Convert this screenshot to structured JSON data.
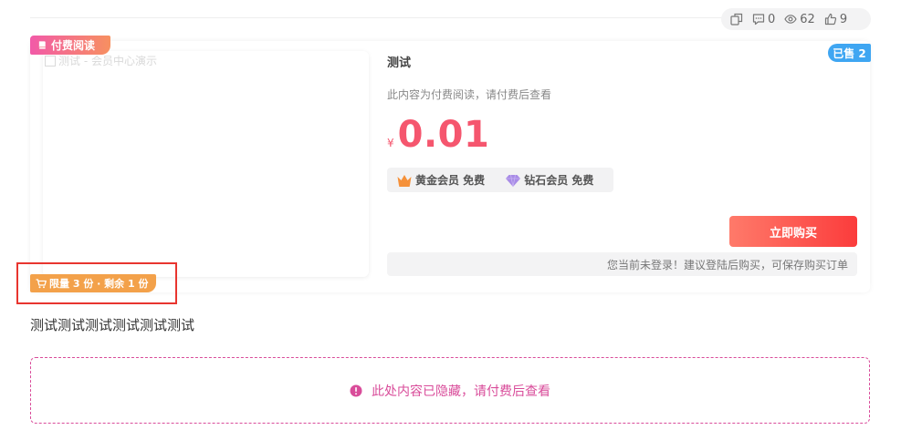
{
  "stats": {
    "comments": "0",
    "views": "62",
    "likes": "9"
  },
  "card": {
    "paid_tag": "付费阅读",
    "sold_badge": "已售 2",
    "cover_alt": "测试 - 会员中心演示",
    "title": "测试",
    "description": "此内容为付费阅读，请付费后查看",
    "price_currency": "¥",
    "price_value": "0.01",
    "members": [
      {
        "label": "黄金会员 免费",
        "icon": "crown-icon",
        "color": "#f5913a"
      },
      {
        "label": "钻石会员 免费",
        "icon": "diamond-icon",
        "color": "#9b7bd9"
      }
    ],
    "buy_button": "立即购买",
    "login_tip": "您当前未登录！建议登陆后购买，可保存购买订单",
    "limit_tag": "限量 3 份 · 剩余 1 份"
  },
  "content": {
    "body_text": "测试测试测试测试测试测试",
    "hidden_notice": "此处内容已隐藏，请付费后查看"
  },
  "colors": {
    "price": "#f5566e",
    "accent_pink": "#d94c9a",
    "buy_button": "#fb3c3c",
    "sold_badge": "#3fa6f2",
    "limit_tag": "#f3a14a",
    "highlight_border": "#e8352f"
  }
}
